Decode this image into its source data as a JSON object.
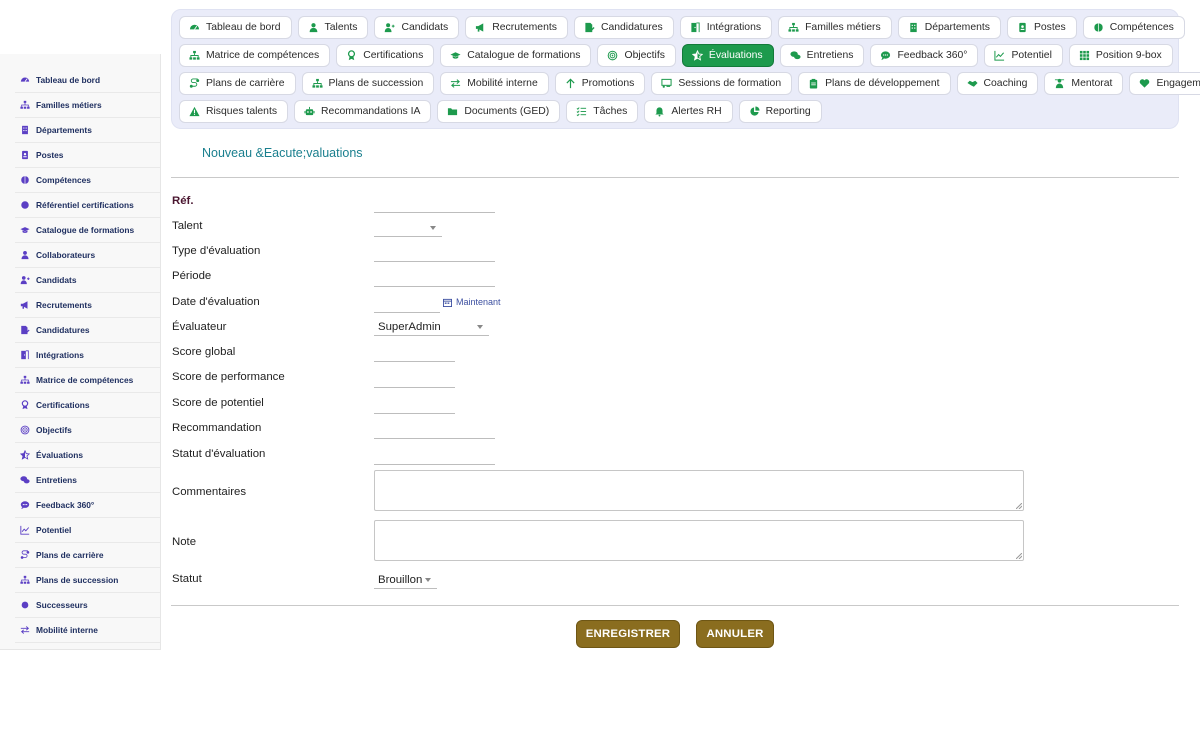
{
  "sidebar": {
    "items": [
      {
        "label": "Tableau de bord",
        "icon": "dashboard-icon"
      },
      {
        "label": "Familles métiers",
        "icon": "sitemap-icon"
      },
      {
        "label": "Départements",
        "icon": "building-icon"
      },
      {
        "label": "Postes",
        "icon": "id-badge-icon"
      },
      {
        "label": "Compétences",
        "icon": "brain-icon"
      },
      {
        "label": "Référentiel certifications",
        "icon": "certificate-icon"
      },
      {
        "label": "Catalogue de formations",
        "icon": "graduation-cap-icon"
      },
      {
        "label": "Collaborateurs",
        "icon": "user-icon"
      },
      {
        "label": "Candidats",
        "icon": "user-plus-icon"
      },
      {
        "label": "Recrutements",
        "icon": "megaphone-icon"
      },
      {
        "label": "Candidatures",
        "icon": "file-signature-icon"
      },
      {
        "label": "Intégrations",
        "icon": "door-open-icon"
      },
      {
        "label": "Matrice de compétences",
        "icon": "sitemap-icon"
      },
      {
        "label": "Certifications",
        "icon": "award-icon"
      },
      {
        "label": "Objectifs",
        "icon": "target-icon"
      },
      {
        "label": "Évaluations",
        "icon": "star-half-icon"
      },
      {
        "label": "Entretiens",
        "icon": "comments-icon"
      },
      {
        "label": "Feedback 360°",
        "icon": "comment-dots-icon"
      },
      {
        "label": "Potentiel",
        "icon": "chart-line-icon"
      },
      {
        "label": "Plans de carrière",
        "icon": "route-icon"
      },
      {
        "label": "Plans de succession",
        "icon": "sitemap-icon"
      },
      {
        "label": "Successeurs",
        "icon": "users-icon"
      },
      {
        "label": "Mobilité interne",
        "icon": "exchange-icon"
      }
    ]
  },
  "topmenu": {
    "rows": [
      [
        {
          "label": "Tableau de bord",
          "icon": "dashboard-icon"
        },
        {
          "label": "Talents",
          "icon": "user-icon"
        },
        {
          "label": "Candidats",
          "icon": "user-plus-icon"
        },
        {
          "label": "Recrutements",
          "icon": "megaphone-icon"
        },
        {
          "label": "Candidatures",
          "icon": "file-signature-icon"
        },
        {
          "label": "Intégrations",
          "icon": "door-open-icon"
        },
        {
          "label": "Familles métiers",
          "icon": "sitemap-icon"
        },
        {
          "label": "Départements",
          "icon": "building-icon"
        },
        {
          "label": "Postes",
          "icon": "id-badge-icon"
        },
        {
          "label": "Compétences",
          "icon": "brain-icon"
        }
      ],
      [
        {
          "label": "Matrice de compétences",
          "icon": "sitemap-icon"
        },
        {
          "label": "Certifications",
          "icon": "award-icon"
        },
        {
          "label": "Catalogue de formations",
          "icon": "graduation-cap-icon"
        },
        {
          "label": "Objectifs",
          "icon": "target-icon"
        },
        {
          "label": "Évaluations",
          "icon": "star-half-icon",
          "active": true
        },
        {
          "label": "Entretiens",
          "icon": "comments-icon"
        },
        {
          "label": "Feedback 360°",
          "icon": "comment-dots-icon"
        },
        {
          "label": "Potentiel",
          "icon": "chart-line-icon"
        },
        {
          "label": "Position 9-box",
          "icon": "grid-icon"
        }
      ],
      [
        {
          "label": "Plans de carrière",
          "icon": "route-icon"
        },
        {
          "label": "Plans de succession",
          "icon": "sitemap-icon"
        },
        {
          "label": "Mobilité interne",
          "icon": "exchange-icon"
        },
        {
          "label": "Promotions",
          "icon": "arrow-up-icon"
        },
        {
          "label": "Sessions de formation",
          "icon": "chalkboard-icon"
        },
        {
          "label": "Plans de développement",
          "icon": "clipboard-icon"
        },
        {
          "label": "Coaching",
          "icon": "handshake-icon"
        },
        {
          "label": "Mentorat",
          "icon": "mentor-icon"
        },
        {
          "label": "Engagement",
          "icon": "heart-icon"
        }
      ],
      [
        {
          "label": "Risques talents",
          "icon": "warning-icon"
        },
        {
          "label": "Recommandations IA",
          "icon": "robot-icon"
        },
        {
          "label": "Documents (GED)",
          "icon": "folder-icon"
        },
        {
          "label": "Tâches",
          "icon": "tasks-icon"
        },
        {
          "label": "Alertes RH",
          "icon": "bell-icon"
        },
        {
          "label": "Reporting",
          "icon": "chart-pie-icon"
        }
      ]
    ]
  },
  "form": {
    "title": "Nouveau &Eacute;valuations",
    "fields": {
      "ref": "Réf.",
      "talent": "Talent",
      "type": "Type d'évaluation",
      "periode": "Période",
      "date": "Date d'évaluation",
      "evaluateur": "Évaluateur",
      "score_global": "Score global",
      "score_perf": "Score de performance",
      "score_pot": "Score de potentiel",
      "recommandation": "Recommandation",
      "statut_eval": "Statut d'évaluation",
      "commentaires": "Commentaires",
      "note": "Note",
      "statut": "Statut"
    },
    "values": {
      "evaluateur": "SuperAdmin",
      "statut": "Brouillon"
    },
    "now_link": "Maintenant",
    "save": "ENREGISTRER",
    "cancel": "ANNULER"
  },
  "colors": {
    "active_green": "#1d9a4d",
    "button_gold": "#8a6d1f",
    "title_teal": "#1a7f8e",
    "menu_bg": "#eaecf9",
    "sidebar_text": "#1f2f60"
  }
}
